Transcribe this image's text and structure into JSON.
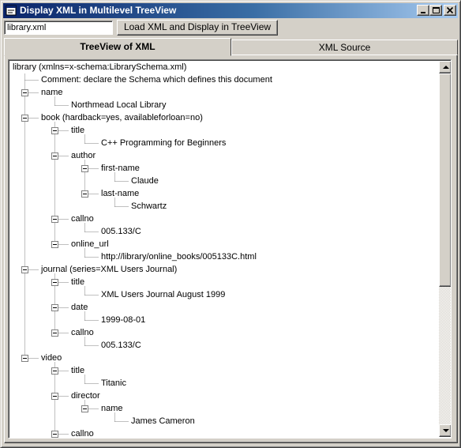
{
  "window": {
    "title": "Display XML in Multilevel TreeView"
  },
  "toolbar": {
    "file_value": "library.xml",
    "load_label": "Load XML and Display in TreeView"
  },
  "tabs": [
    {
      "label": "TreeView of XML",
      "active": true
    },
    {
      "label": "XML Source",
      "active": false
    }
  ],
  "tree": {
    "nodes": [
      {
        "level": 0,
        "text": "library (xmlns=x-schema:LibrarySchema.xml)",
        "expander": "none"
      },
      {
        "level": 1,
        "text": "Comment: declare the Schema which defines this document",
        "expander": "none"
      },
      {
        "level": 1,
        "text": "name",
        "expander": "expanded"
      },
      {
        "level": 2,
        "text": "Northmead Local Library",
        "expander": "none"
      },
      {
        "level": 1,
        "text": "book (hardback=yes, availableforloan=no)",
        "expander": "expanded"
      },
      {
        "level": 2,
        "text": "title",
        "expander": "expanded"
      },
      {
        "level": 3,
        "text": "C++ Programming for Beginners",
        "expander": "none"
      },
      {
        "level": 2,
        "text": "author",
        "expander": "expanded"
      },
      {
        "level": 3,
        "text": "first-name",
        "expander": "expanded"
      },
      {
        "level": 4,
        "text": "Claude",
        "expander": "none"
      },
      {
        "level": 3,
        "text": "last-name",
        "expander": "expanded"
      },
      {
        "level": 4,
        "text": "Schwartz",
        "expander": "none"
      },
      {
        "level": 2,
        "text": "callno",
        "expander": "expanded"
      },
      {
        "level": 3,
        "text": "005.133/C",
        "expander": "none"
      },
      {
        "level": 2,
        "text": "online_url",
        "expander": "expanded"
      },
      {
        "level": 3,
        "text": "http://library/online_books/005133C.html",
        "expander": "none"
      },
      {
        "level": 1,
        "text": "journal (series=XML Users Journal)",
        "expander": "expanded"
      },
      {
        "level": 2,
        "text": "title",
        "expander": "expanded"
      },
      {
        "level": 3,
        "text": "XML Users Journal August 1999",
        "expander": "none"
      },
      {
        "level": 2,
        "text": "date",
        "expander": "expanded"
      },
      {
        "level": 3,
        "text": "1999-08-01",
        "expander": "none"
      },
      {
        "level": 2,
        "text": "callno",
        "expander": "expanded"
      },
      {
        "level": 3,
        "text": "005.133/C",
        "expander": "none"
      },
      {
        "level": 1,
        "text": "video",
        "expander": "expanded"
      },
      {
        "level": 2,
        "text": "title",
        "expander": "expanded"
      },
      {
        "level": 3,
        "text": "Titanic",
        "expander": "none"
      },
      {
        "level": 2,
        "text": "director",
        "expander": "expanded"
      },
      {
        "level": 3,
        "text": "name",
        "expander": "expanded"
      },
      {
        "level": 4,
        "text": "James Cameron",
        "expander": "none"
      },
      {
        "level": 2,
        "text": "callno",
        "expander": "expanded"
      }
    ]
  }
}
